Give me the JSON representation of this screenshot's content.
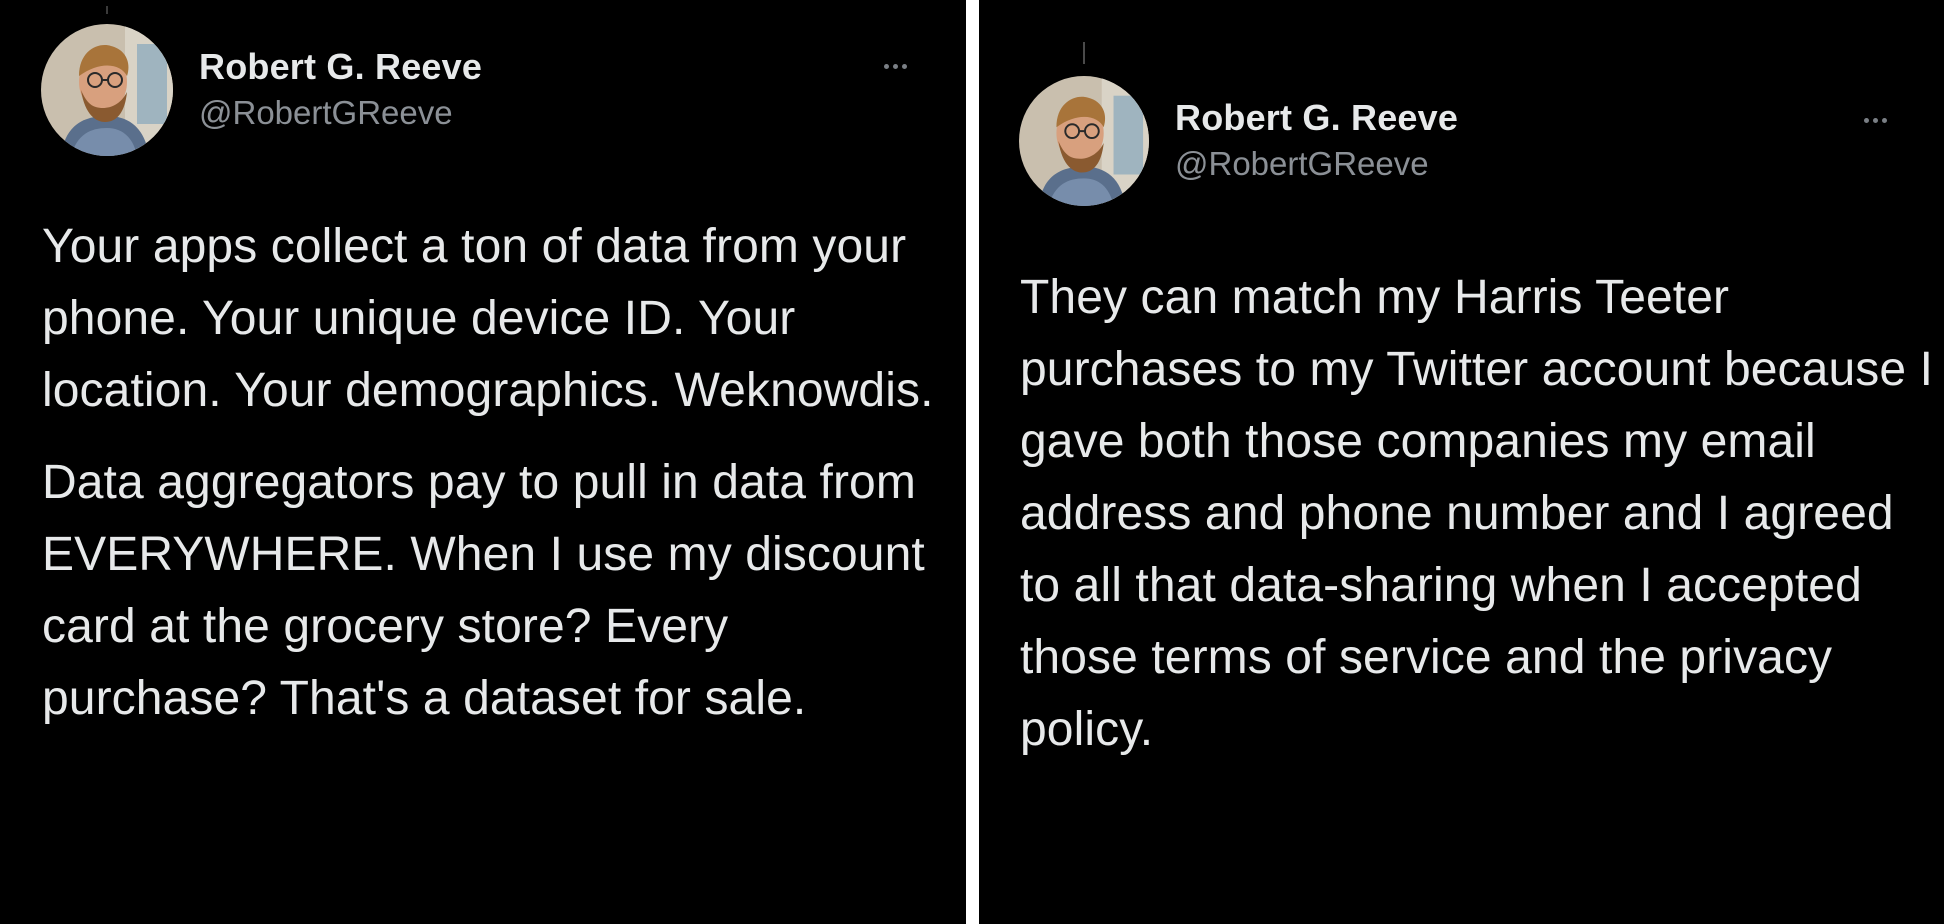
{
  "left_tweet": {
    "author": {
      "display_name": "Robert G. Reeve",
      "handle": "@RobertGReeve",
      "avatar_icon": "profile-photo"
    },
    "more_icon": "more-horizontal-icon",
    "paragraphs": [
      "Your apps collect a ton of data from your phone. Your unique device ID. Your location. Your demographics. Weknowdis.",
      "Data aggregators pay to pull in data from EVERYWHERE. When I use my discount card at the grocery store? Every purchase? That's a dataset for sale."
    ]
  },
  "right_tweet": {
    "author": {
      "display_name": "Robert G. Reeve",
      "handle": "@RobertGReeve",
      "avatar_icon": "profile-photo"
    },
    "more_icon": "more-horizontal-icon",
    "paragraphs": [
      "They can match my Harris Teeter purchases to my Twitter account because I gave both those companies my email address and phone number and I agreed to all that data-sharing when I accepted those terms of service and the privacy policy."
    ]
  },
  "colors": {
    "background": "#000000",
    "text_primary": "#e7e9ea",
    "text_secondary": "#8b9096",
    "divider": "#ffffff"
  }
}
